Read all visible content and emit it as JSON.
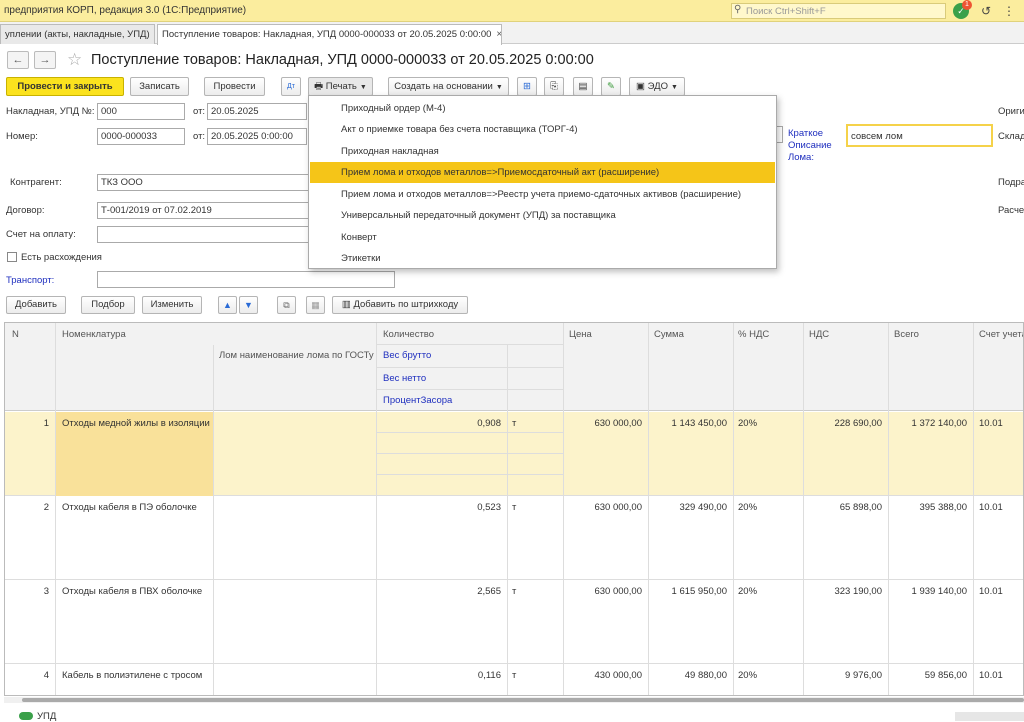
{
  "titlebar": {
    "title": "предприятия КОРП, редакция 3.0  (1С:Предприятие)",
    "search_placeholder": "Поиск Ctrl+Shift+F",
    "notif_count": "1"
  },
  "tabs": [
    {
      "label": "уплении (акты, накладные, УПД)",
      "close": "×"
    },
    {
      "label": "Поступление товаров: Накладная, УПД 0000-000033 от 20.05.2025 0:00:00",
      "close": "×"
    }
  ],
  "page": {
    "title": "Поступление товаров: Накладная, УПД 0000-000033 от 20.05.2025 0:00:00"
  },
  "toolbar": {
    "post_close": "Провести и закрыть",
    "save": "Записать",
    "post": "Провести",
    "print": "Печать",
    "create_based": "Создать на основании",
    "edo": "ЭДО"
  },
  "form": {
    "invoice_label": "Накладная, УПД №:",
    "invoice_value": "000",
    "from_label": "от:",
    "invoice_date": "20.05.2025",
    "number_label": "Номер:",
    "number_value": "0000-000033",
    "number_date": "20.05.2025  0:00:00",
    "counterparty_label": "Контрагент:",
    "counterparty_value": "ТКЗ ООО",
    "contract_label": "Договор:",
    "contract_value": "Т-001/2019 от 07.02.2019",
    "bill_label": "Счет на оплату:",
    "discrepancy_label": "Есть расхождения",
    "transport_label": "Транспорт:",
    "scrap_label": "Краткое Описание Лома:",
    "scrap_value": "совсем лом",
    "right_labels": [
      "Ориги",
      "Склад",
      "Подра",
      "Расче"
    ]
  },
  "table_toolbar": {
    "add": "Добавить",
    "select": "Подбор",
    "change": "Изменить",
    "barcode": "Добавить по штрихкоду"
  },
  "table": {
    "headers": {
      "n": "N",
      "nom": "Номенклатура",
      "scrap": "Лом наименование лома по ГОСТу",
      "qty": "Количество",
      "gross": "Вес брутто",
      "net": "Вес нетто",
      "clog": "ПроцентЗасора",
      "price": "Цена",
      "sum": "Сумма",
      "vat_pct": "% НДС",
      "vat": "НДС",
      "total": "Всего",
      "account": "Счет учета"
    },
    "rows": [
      {
        "n": "1",
        "nom": "Отходы медной жилы в изоляции",
        "qty": "0,908",
        "unit": "т",
        "price": "630 000,00",
        "sum": "1 143 450,00",
        "vat_pct": "20%",
        "vat": "228 690,00",
        "total": "1 372 140,00",
        "account": "10.01"
      },
      {
        "n": "2",
        "nom": "Отходы кабеля в ПЭ оболочке",
        "qty": "0,523",
        "unit": "т",
        "price": "630 000,00",
        "sum": "329 490,00",
        "vat_pct": "20%",
        "vat": "65 898,00",
        "total": "395 388,00",
        "account": "10.01"
      },
      {
        "n": "3",
        "nom": "Отходы кабеля в ПВХ оболочке",
        "qty": "2,565",
        "unit": "т",
        "price": "630 000,00",
        "sum": "1 615 950,00",
        "vat_pct": "20%",
        "vat": "323 190,00",
        "total": "1 939 140,00",
        "account": "10.01"
      },
      {
        "n": "4",
        "nom": "Кабель в полиэтилене с тросом",
        "qty": "0,116",
        "unit": "т",
        "price": "430 000,00",
        "sum": "49 880,00",
        "vat_pct": "20%",
        "vat": "9 976,00",
        "total": "59 856,00",
        "account": "10.01"
      }
    ]
  },
  "print_menu": [
    "Приходный ордер (М-4)",
    "Акт о приемке товара без счета поставщика (ТОРГ-4)",
    "Приходная накладная",
    "Прием лома и отходов металлов=>Приемосдаточный акт (расширение)",
    "Прием лома и отходов металлов=>Реестр учета приемо-сдаточных активов (расширение)",
    "Универсальный передаточный документ (УПД) за поставщика",
    "Конверт",
    "Этикетки"
  ],
  "bottom": {
    "upd_label": "УПД"
  }
}
